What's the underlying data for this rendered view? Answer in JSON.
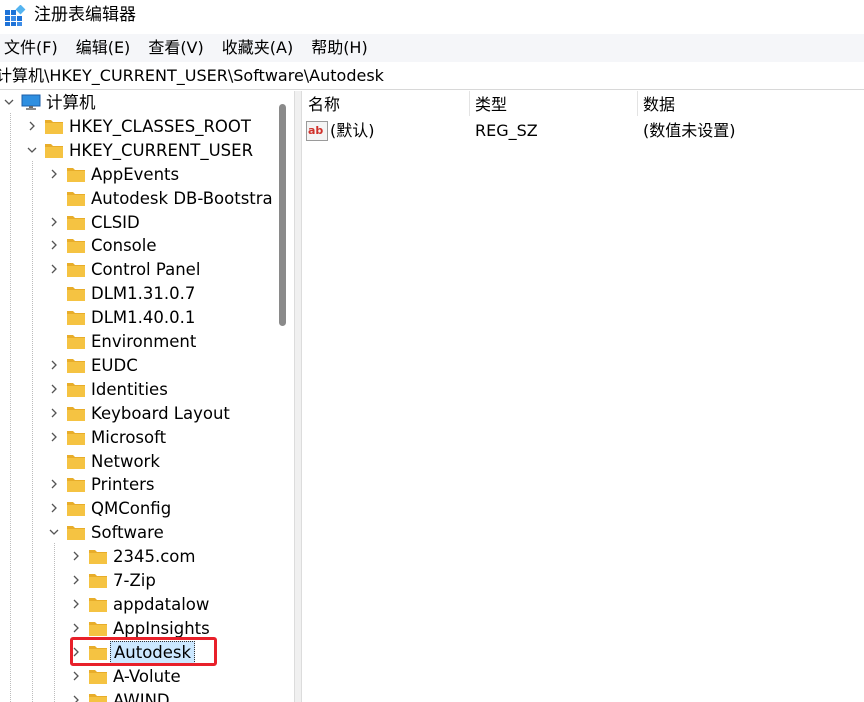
{
  "window": {
    "title": "注册表编辑器",
    "icon": "registry-editor-icon"
  },
  "menu": [
    "文件(F)",
    "编辑(E)",
    "查看(V)",
    "收藏夹(A)",
    "帮助(H)"
  ],
  "address": "计算机\\HKEY_CURRENT_USER\\Software\\Autodesk",
  "tree": {
    "root": "计算机",
    "hives": [
      "HKEY_CLASSES_ROOT",
      "HKEY_CURRENT_USER"
    ],
    "hkcu_children": [
      {
        "label": "AppEvents",
        "expandable": true
      },
      {
        "label": "Autodesk DB-Bootstra",
        "expandable": false
      },
      {
        "label": "CLSID",
        "expandable": true
      },
      {
        "label": "Console",
        "expandable": true
      },
      {
        "label": "Control Panel",
        "expandable": true
      },
      {
        "label": "DLM1.31.0.7",
        "expandable": false
      },
      {
        "label": "DLM1.40.0.1",
        "expandable": false
      },
      {
        "label": "Environment",
        "expandable": false
      },
      {
        "label": "EUDC",
        "expandable": true
      },
      {
        "label": "Identities",
        "expandable": true
      },
      {
        "label": "Keyboard Layout",
        "expandable": true
      },
      {
        "label": "Microsoft",
        "expandable": true
      },
      {
        "label": "Network",
        "expandable": false
      },
      {
        "label": "Printers",
        "expandable": true
      },
      {
        "label": "QMConfig",
        "expandable": true
      },
      {
        "label": "Software",
        "expandable": true,
        "expanded": true
      }
    ],
    "software_children": [
      {
        "label": "2345.com",
        "expandable": true
      },
      {
        "label": "7-Zip",
        "expandable": true
      },
      {
        "label": "appdatalow",
        "expandable": true
      },
      {
        "label": "AppInsights",
        "expandable": true
      },
      {
        "label": "Autodesk",
        "expandable": true,
        "selected": true
      },
      {
        "label": "A-Volute",
        "expandable": true
      },
      {
        "label": "AWIND",
        "expandable": true
      }
    ]
  },
  "list": {
    "columns": [
      "名称",
      "类型",
      "数据"
    ],
    "rows": [
      {
        "name": "(默认)",
        "type": "REG_SZ",
        "data": "(数值未设置)",
        "icon": "string-value-icon"
      }
    ]
  },
  "colors": {
    "selection_bg": "#cce8ff",
    "highlight_border": "#e8202a",
    "folder": "#f5c342"
  }
}
